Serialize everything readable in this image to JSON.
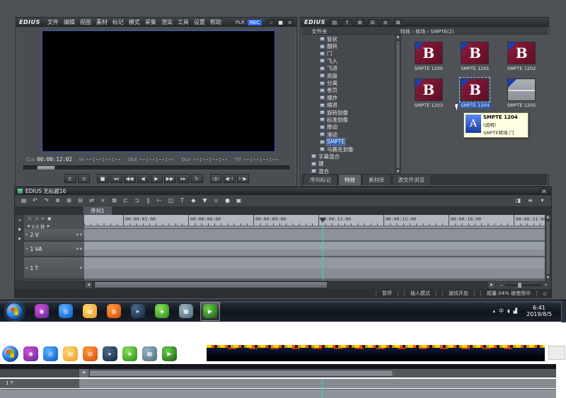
{
  "colors": {
    "rec_badge": "#2d6bff",
    "selection_blue": "#2f5fb8",
    "playhead_teal": "#2fd8c8",
    "tooltip_bg": "#ffffe1",
    "thumb_red": "#7c1230",
    "thumb_corner_blue": "#1d3fae",
    "preview_border_blue": "#3a57c8"
  },
  "player": {
    "logo": "EDIUS",
    "menus": [
      {
        "label": "文件"
      },
      {
        "label": "编辑"
      },
      {
        "label": "视图"
      },
      {
        "label": "素材"
      },
      {
        "label": "标记"
      },
      {
        "label": "模式"
      },
      {
        "label": "采集"
      },
      {
        "label": "渲染"
      },
      {
        "label": "工具"
      },
      {
        "label": "设置"
      },
      {
        "label": "帮助"
      }
    ],
    "plr_label": "PLR",
    "rec_label": "REC",
    "window_buttons": [
      {
        "name": "minimize",
        "glyph": "–"
      },
      {
        "name": "maximize",
        "glyph": "■"
      },
      {
        "name": "close",
        "glyph": "×"
      }
    ],
    "timecodes": [
      {
        "label": "Cur",
        "value": "00:00:12:02"
      },
      {
        "label": "In",
        "value": "--:--:--:--"
      },
      {
        "label": "Out",
        "value": "--:--:--:--"
      },
      {
        "label": "Dur",
        "value": "--:--:--:--"
      },
      {
        "label": "Ttl",
        "value": "--:--:--:--"
      }
    ],
    "transport_left": [
      {
        "name": "mark-in-button",
        "glyph": "⊏"
      },
      {
        "name": "mark-out-button",
        "glyph": "⊐"
      }
    ],
    "transport": [
      {
        "name": "stop-button",
        "glyph": "■"
      },
      {
        "name": "prev-edit-button",
        "glyph": "◂◂"
      },
      {
        "name": "rewind-button",
        "glyph": "◀◀"
      },
      {
        "name": "frame-back-button",
        "glyph": "◀"
      },
      {
        "name": "play-button",
        "glyph": "▶"
      },
      {
        "name": "fast-forward-button",
        "glyph": "▶▶"
      },
      {
        "name": "next-edit-button",
        "glyph": "▸▸"
      },
      {
        "name": "loop-button",
        "glyph": "↻"
      }
    ],
    "transport_right": [
      {
        "name": "play-in-to-out-button",
        "glyph": "◁▷"
      },
      {
        "name": "goto-in-button",
        "glyph": "◀⊣"
      },
      {
        "name": "goto-out-button",
        "glyph": "⊢▶"
      }
    ]
  },
  "effects": {
    "logo": "EDIUS",
    "toolbar": [
      {
        "name": "new-folder-button",
        "glyph": "▤"
      },
      {
        "name": "folder-up-button",
        "glyph": "↑"
      },
      {
        "name": "thumbnail-view-button",
        "glyph": "⊞"
      },
      {
        "name": "list-view-button",
        "glyph": "⊟"
      },
      {
        "name": "details-button",
        "glyph": "≡"
      },
      {
        "name": "lock-button",
        "glyph": "⊠"
      }
    ],
    "left_header": "文件夹",
    "breadcrumb": "特效 › 转场 › SMPTE(2)",
    "scroll_up": "▲",
    "scroll_down": "▼",
    "tree": [
      {
        "label": "管状",
        "lvl": "l3"
      },
      {
        "label": "翻转",
        "lvl": "l3"
      },
      {
        "label": "门",
        "lvl": "l3"
      },
      {
        "label": "飞入",
        "lvl": "l3"
      },
      {
        "label": "飞进",
        "lvl": "l3"
      },
      {
        "label": "高级",
        "lvl": "l3"
      },
      {
        "label": "分离",
        "lvl": "l3"
      },
      {
        "label": "卷页",
        "lvl": "l3"
      },
      {
        "label": "爆炸",
        "lvl": "l3"
      },
      {
        "label": "缩退",
        "lvl": "l3"
      },
      {
        "label": "旋转划像",
        "lvl": "l3"
      },
      {
        "label": "标准划像",
        "lvl": "l3"
      },
      {
        "label": "推动",
        "lvl": "l3"
      },
      {
        "label": "滑动",
        "lvl": "l3"
      },
      {
        "label": "SMPTE",
        "lvl": "l3",
        "state": "selected"
      },
      {
        "label": "马赛克划像",
        "lvl": "l3"
      },
      {
        "label": "字幕混合",
        "lvl": "l2"
      },
      {
        "label": "键",
        "lvl": "l2"
      },
      {
        "label": "混合",
        "lvl": "l2"
      }
    ],
    "thumbnails": [
      {
        "label": "SMPTE 1200",
        "letter": "B",
        "variant": "red"
      },
      {
        "label": "SMPTE 1201",
        "letter": "B",
        "variant": "red"
      },
      {
        "label": "SMPTE 1202",
        "letter": "B",
        "variant": "red"
      },
      {
        "label": "SMPTE 1203",
        "letter": "B",
        "variant": "red"
      },
      {
        "label": "SMPTE 1204",
        "letter": "B",
        "variant": "red",
        "state": "selected"
      },
      {
        "label": "SMPTE 1205",
        "letter": "",
        "variant": "gray"
      }
    ],
    "tooltip": {
      "title": "SMPTE 1204",
      "subtitle": "(说明)",
      "description": "SMPTE转场 门",
      "icon_letter": "A"
    },
    "tabs": [
      {
        "label": "序列标记"
      },
      {
        "label": "特效",
        "state": "active"
      },
      {
        "label": "素材库"
      },
      {
        "label": "源文件浏览"
      }
    ]
  },
  "timeline": {
    "title": "EDIUS 无标题16",
    "close_glyph": "×",
    "toolbar": [
      {
        "name": "save-button",
        "glyph": "▤"
      },
      {
        "name": "undo-button",
        "glyph": "↶"
      },
      {
        "name": "redo-button",
        "glyph": "↷"
      },
      {
        "name": "cut-button",
        "glyph": "⊗"
      },
      {
        "name": "copy-button",
        "glyph": "⊞"
      },
      {
        "name": "paste-button",
        "glyph": "⊟"
      },
      {
        "name": "replace-button",
        "glyph": "⇄"
      },
      {
        "name": "delete-button",
        "glyph": "×"
      },
      {
        "name": "ripple-delete-button",
        "glyph": "⊠"
      },
      {
        "name": "set-in-button",
        "glyph": "⊏"
      },
      {
        "name": "set-out-button",
        "glyph": "⊐"
      },
      {
        "name": "add-cut-point-button",
        "glyph": "∥"
      },
      {
        "name": "trim-button",
        "glyph": "⊢"
      },
      {
        "name": "add-transition-button",
        "glyph": "◫"
      },
      {
        "name": "title-button",
        "glyph": "T"
      },
      {
        "name": "keyframe-button",
        "glyph": "◆"
      },
      {
        "name": "marker-button",
        "glyph": "▼"
      },
      {
        "name": "snap-button",
        "glyph": "∪"
      },
      {
        "name": "record-button",
        "glyph": "●"
      },
      {
        "name": "export-button",
        "glyph": "▣"
      }
    ],
    "toolbar_right": [
      {
        "name": "panel-toggle-button",
        "glyph": "◨"
      },
      {
        "name": "options-menu-button",
        "glyph": "≡"
      },
      {
        "name": "collapse-button",
        "glyph": "▾"
      }
    ],
    "sequence_tab": "序列1",
    "rail": [
      {
        "name": "collapse-rail-button",
        "glyph": "◂"
      },
      {
        "name": "marker-rail-button",
        "glyph": "◆"
      },
      {
        "name": "lock-rail-button",
        "glyph": "▪"
      }
    ],
    "hdr_icons": [
      {
        "name": "sync-lock-icon",
        "glyph": "⊏"
      },
      {
        "name": "sync-lock2-icon",
        "glyph": "⊐"
      },
      {
        "name": "ripple-icon",
        "glyph": "∞"
      },
      {
        "name": "mute-icon",
        "glyph": "●"
      }
    ],
    "scale_prev": "◀",
    "scale_value": "0.5 秒",
    "scale_next": "▶",
    "ruler_labels": [
      "00:00:03:00",
      "00:00:06:00",
      "00:00:09:00",
      "00:00:12:00",
      "00:00:15:00",
      "00:00:18:00",
      "00:00:21:00"
    ],
    "tracks": [
      {
        "name": "2 V",
        "cls": "trk-v",
        "exp": "▸",
        "btns": "▪ ▪"
      },
      {
        "name": "1 VA",
        "cls": "trk-va",
        "exp": "▸",
        "btns": "▪ ▪"
      },
      {
        "name": "1 T",
        "cls": "trk-t",
        "exp": "▸",
        "btns": "▪"
      }
    ],
    "vscroll_up": "▲",
    "vscroll_down": "▼",
    "hscroll": {
      "left": "◀",
      "right": "▶",
      "zoom_out": "−",
      "zoom_in": "+"
    },
    "status": [
      {
        "label": "暂停"
      },
      {
        "label": "插入模式"
      },
      {
        "label": "波纹开启"
      },
      {
        "label": "超量:04% 被使用中"
      }
    ],
    "status_icon": "⊙"
  },
  "taskbar": {
    "icons": [
      {
        "name": "media-player",
        "glyph": "◉",
        "c1": "#d44fd0",
        "c2": "#5a2a9e"
      },
      {
        "name": "browser",
        "glyph": "◎",
        "c1": "#5ab4ff",
        "c2": "#0a56c4"
      },
      {
        "name": "file-explorer",
        "glyph": "▤",
        "c1": "#ffd76e",
        "c2": "#e89c2a"
      },
      {
        "name": "firefox",
        "glyph": "◍",
        "c1": "#ff9a3c",
        "c2": "#d44a10"
      },
      {
        "name": "video-app",
        "glyph": "▸",
        "c1": "#4a6a8a",
        "c2": "#16283c"
      },
      {
        "name": "green-app",
        "glyph": "◈",
        "c1": "#8ae05a",
        "c2": "#2a8a1a"
      },
      {
        "name": "utility-app",
        "glyph": "▦",
        "c1": "#9ab4c4",
        "c2": "#4a6a7a"
      },
      {
        "name": "edius",
        "glyph": "▶",
        "c1": "#6ad04a",
        "c2": "#1a5a14",
        "state": "active"
      }
    ],
    "tray_icons": [
      {
        "name": "show-hidden-icon",
        "glyph": "▴"
      },
      {
        "name": "ime-icon",
        "glyph": "中"
      },
      {
        "name": "volume-icon",
        "glyph": "◖"
      },
      {
        "name": "network-icon",
        "glyph": "▟"
      }
    ],
    "clock": {
      "time": "6:41",
      "date": "2019/8/5"
    }
  },
  "glitch": {
    "track_label": "1 T",
    "scroll_arrow": "◀"
  }
}
